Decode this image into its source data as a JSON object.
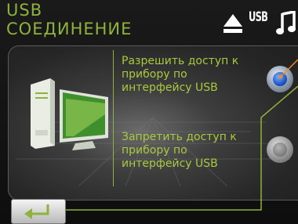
{
  "header": {
    "title_line1": "USB",
    "title_line2": "СОЕДИНЕНИЕ",
    "usb_label": "USB",
    "icons": [
      "eject-icon",
      "usb-icon",
      "music-note-icon"
    ]
  },
  "options": [
    {
      "label": "Разрешить доступ к\nприбору по\nинтерфейсу USB",
      "selected": true
    },
    {
      "label": "Запретить доступ к\nприбору по\nинтерфейсу USB",
      "selected": false
    }
  ],
  "footer": {
    "back_icon": "back-arrow-icon"
  },
  "colors": {
    "accent": "#8fb23a",
    "text": "#a8c93c",
    "highlight": "#f08c1e",
    "selected_radio": "#1e55c8"
  }
}
